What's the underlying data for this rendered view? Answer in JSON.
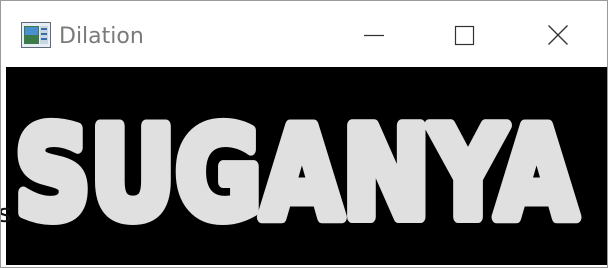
{
  "window": {
    "title": "Dilation",
    "icon": "opencv-window-icon",
    "controls": {
      "minimize": "minimize-icon",
      "maximize": "maximize-icon",
      "close": "close-icon"
    }
  },
  "image": {
    "text": "SUGANYA",
    "foreground_color": "#e0e0e0",
    "background_color": "#000000"
  },
  "stray_glyph": "s"
}
